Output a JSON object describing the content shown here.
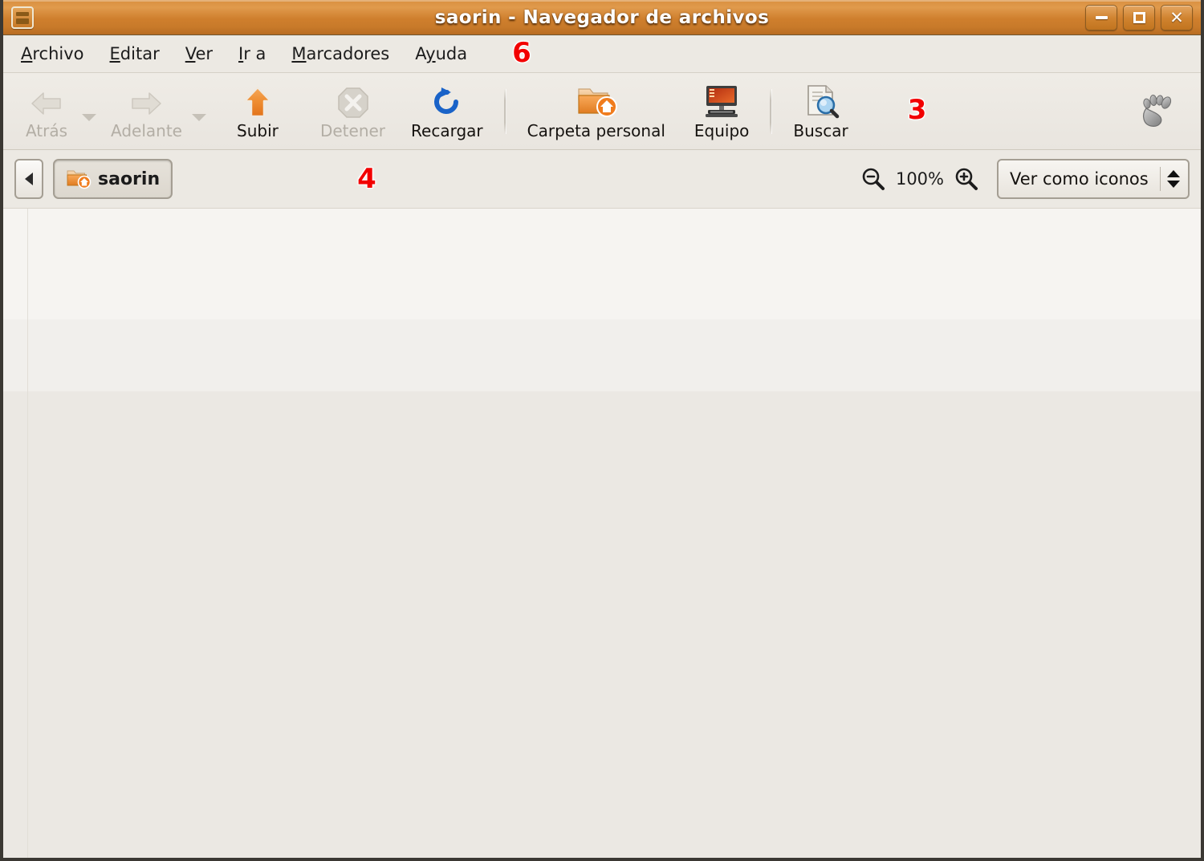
{
  "window": {
    "title": "saorin - Navegador de archivos",
    "icon": "file-manager-icon",
    "controls": {
      "minimize": "minimize-button",
      "maximize": "maximize-button",
      "close": "close-button"
    }
  },
  "menubar": {
    "items": [
      {
        "label": "Archivo",
        "accel": "A"
      },
      {
        "label": "Editar",
        "accel": "E"
      },
      {
        "label": "Ver",
        "accel": "V"
      },
      {
        "label": "Ir a",
        "accel": "I"
      },
      {
        "label": "Marcadores",
        "accel": "M"
      },
      {
        "label": "Ayuda",
        "accel": "y"
      }
    ]
  },
  "toolbar": {
    "back": {
      "label": "Atrás",
      "icon": "back-arrow-icon",
      "enabled": false
    },
    "forward": {
      "label": "Adelante",
      "icon": "forward-arrow-icon",
      "enabled": false
    },
    "up": {
      "label": "Subir",
      "icon": "up-arrow-icon",
      "enabled": true
    },
    "stop": {
      "label": "Detener",
      "icon": "stop-icon",
      "enabled": false
    },
    "reload": {
      "label": "Recargar",
      "icon": "reload-icon",
      "enabled": true
    },
    "home": {
      "label": "Carpeta personal",
      "icon": "home-folder-icon",
      "enabled": true
    },
    "computer": {
      "label": "Equipo",
      "icon": "computer-icon",
      "enabled": true
    },
    "search": {
      "label": "Buscar",
      "icon": "search-document-icon",
      "enabled": true
    },
    "branding": {
      "icon": "gnome-foot-icon"
    }
  },
  "locationbar": {
    "scroll_left": "path-scroll-left",
    "breadcrumb": [
      {
        "label": "saorin",
        "icon": "home-folder-icon",
        "active": true
      }
    ],
    "zoom_out": "zoom-out-icon",
    "zoom_level": "100%",
    "zoom_in": "zoom-in-icon",
    "view_mode": "Ver como iconos"
  },
  "annotations": [
    {
      "id": "annot-3",
      "text": "3"
    },
    {
      "id": "annot-4",
      "text": "4"
    },
    {
      "id": "annot-6",
      "text": "6"
    }
  ],
  "colors": {
    "titlebar_orange": "#cf7f2d",
    "chrome_grey": "#ece9e3",
    "annotation_red": "#f20000",
    "accent_orange": "#e8792a"
  },
  "content": {
    "files": []
  }
}
